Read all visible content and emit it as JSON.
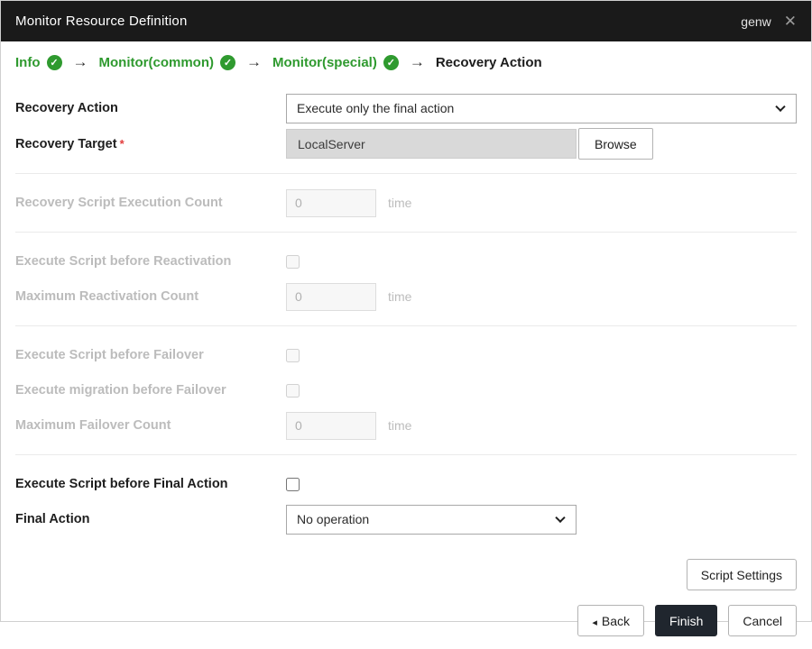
{
  "header": {
    "title": "Monitor Resource Definition",
    "monitor_name": "genw",
    "close_icon": "✕"
  },
  "steps": {
    "arrow": "→",
    "check": "✓",
    "items": [
      {
        "label": "Info",
        "state": "done"
      },
      {
        "label": "Monitor(common)",
        "state": "done"
      },
      {
        "label": "Monitor(special)",
        "state": "done"
      },
      {
        "label": "Recovery Action",
        "state": "current"
      }
    ]
  },
  "form": {
    "recovery_action": {
      "label": "Recovery Action",
      "value": "Execute only the final action"
    },
    "recovery_target": {
      "label": "Recovery Target",
      "required_mark": "*",
      "value": "LocalServer",
      "browse_label": "Browse"
    },
    "recovery_script_execution_count": {
      "label": "Recovery Script Execution Count",
      "value": "0",
      "unit": "time"
    },
    "execute_script_before_reactivation": {
      "label": "Execute Script before Reactivation"
    },
    "maximum_reactivation_count": {
      "label": "Maximum Reactivation Count",
      "value": "0",
      "unit": "time"
    },
    "execute_script_before_failover": {
      "label": "Execute Script before Failover"
    },
    "execute_migration_before_failover": {
      "label": "Execute migration before Failover"
    },
    "maximum_failover_count": {
      "label": "Maximum Failover Count",
      "value": "0",
      "unit": "time"
    },
    "execute_script_before_final_action": {
      "label": "Execute Script before Final Action"
    },
    "final_action": {
      "label": "Final Action",
      "value": "No operation"
    },
    "script_settings_label": "Script Settings"
  },
  "footer": {
    "back_icon": "◂",
    "back_label": "Back",
    "finish_label": "Finish",
    "cancel_label": "Cancel"
  },
  "colors": {
    "accent_green": "#2f9a2f",
    "header_bg": "#1a1a1a",
    "finish_bg": "#20262e",
    "required_red": "#e23c3c"
  }
}
